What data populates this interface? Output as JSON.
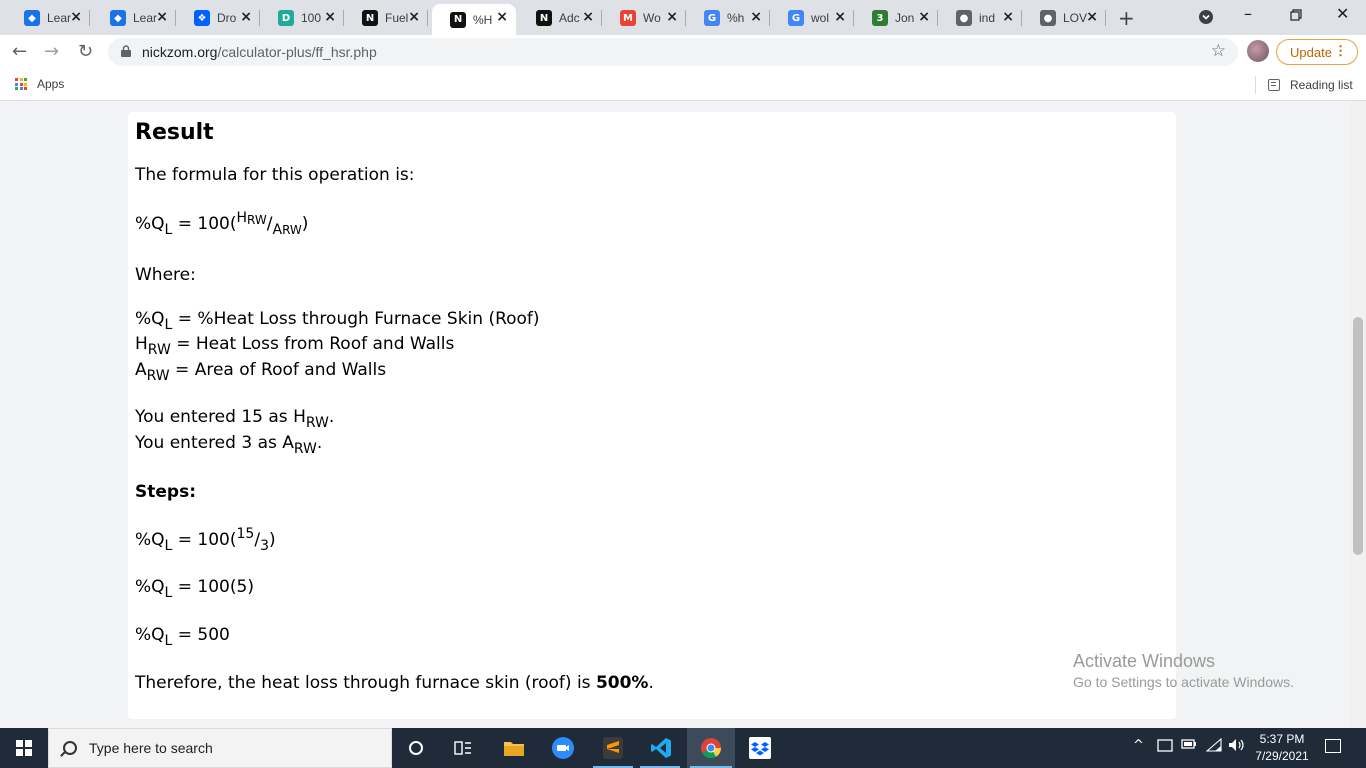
{
  "tabs": [
    {
      "title": "Lear",
      "favicon_color": "#1a73e8",
      "favicon_glyph": "◆",
      "icon": "learn-icon"
    },
    {
      "title": "Lear",
      "favicon_color": "#1a73e8",
      "favicon_glyph": "◆",
      "icon": "learn-icon"
    },
    {
      "title": "Dro",
      "favicon_color": "#0061fe",
      "favicon_glyph": "❖",
      "icon": "dropbox-icon"
    },
    {
      "title": "100",
      "favicon_color": "#23a99a",
      "favicon_glyph": "D",
      "icon": "doc-icon"
    },
    {
      "title": "Fuel",
      "favicon_color": "#111111",
      "favicon_glyph": "N",
      "icon": "nickzom-icon"
    },
    {
      "title": "%H",
      "favicon_color": "#111111",
      "favicon_glyph": "N",
      "icon": "nickzom-icon"
    },
    {
      "title": "Adc",
      "favicon_color": "#111111",
      "favicon_glyph": "N",
      "icon": "nickzom-icon"
    },
    {
      "title": "Wo",
      "favicon_color": "#ea4335",
      "favicon_glyph": "M",
      "icon": "gmail-icon"
    },
    {
      "title": "%h",
      "favicon_color": "#4285f4",
      "favicon_glyph": "G",
      "icon": "google-icon"
    },
    {
      "title": "wol",
      "favicon_color": "#4285f4",
      "favicon_glyph": "G",
      "icon": "google-icon"
    },
    {
      "title": "Jon",
      "favicon_color": "#2e7d32",
      "favicon_glyph": "3",
      "icon": "jobs-icon"
    },
    {
      "title": "ind",
      "favicon_color": "#5f6368",
      "favicon_glyph": "●",
      "icon": "globe-icon"
    },
    {
      "title": "LOV",
      "favicon_color": "#5f6368",
      "favicon_glyph": "●",
      "icon": "globe-icon"
    }
  ],
  "address": {
    "domain": "nickzom.org",
    "path": "/calculator-plus/ff_hsr.php"
  },
  "update_label": "Update",
  "bookmarks": {
    "apps_label": "Apps",
    "reading_list_label": "Reading list"
  },
  "result": {
    "heading": "Result",
    "formula_intro": "The formula for this operation is:",
    "where_label": "Where:",
    "def1_text": "%Heat Loss through Furnace Skin (Roof)",
    "def2_text": "Heat Loss from Roof and Walls",
    "def3_text": "Area of Roof and Walls",
    "entered1_pre": "You entered",
    "entered1_value": "15",
    "entered2_pre": "You entered",
    "entered2_value": "3",
    "steps_label": "Steps:",
    "step1_num": "15",
    "step1_den": "3",
    "step2_value": "100(5)",
    "step3_value": "500",
    "conclusion_pre": "Therefore, the heat loss through furnace skin (roof) is",
    "conclusion_value": "500%",
    "conclusion_post": "."
  },
  "watermark": {
    "line1": "Activate Windows",
    "line2": "Go to Settings to activate Windows."
  },
  "taskbar": {
    "search_placeholder": "Type here to search",
    "time": "5:37 PM",
    "date": "7/29/2021"
  }
}
